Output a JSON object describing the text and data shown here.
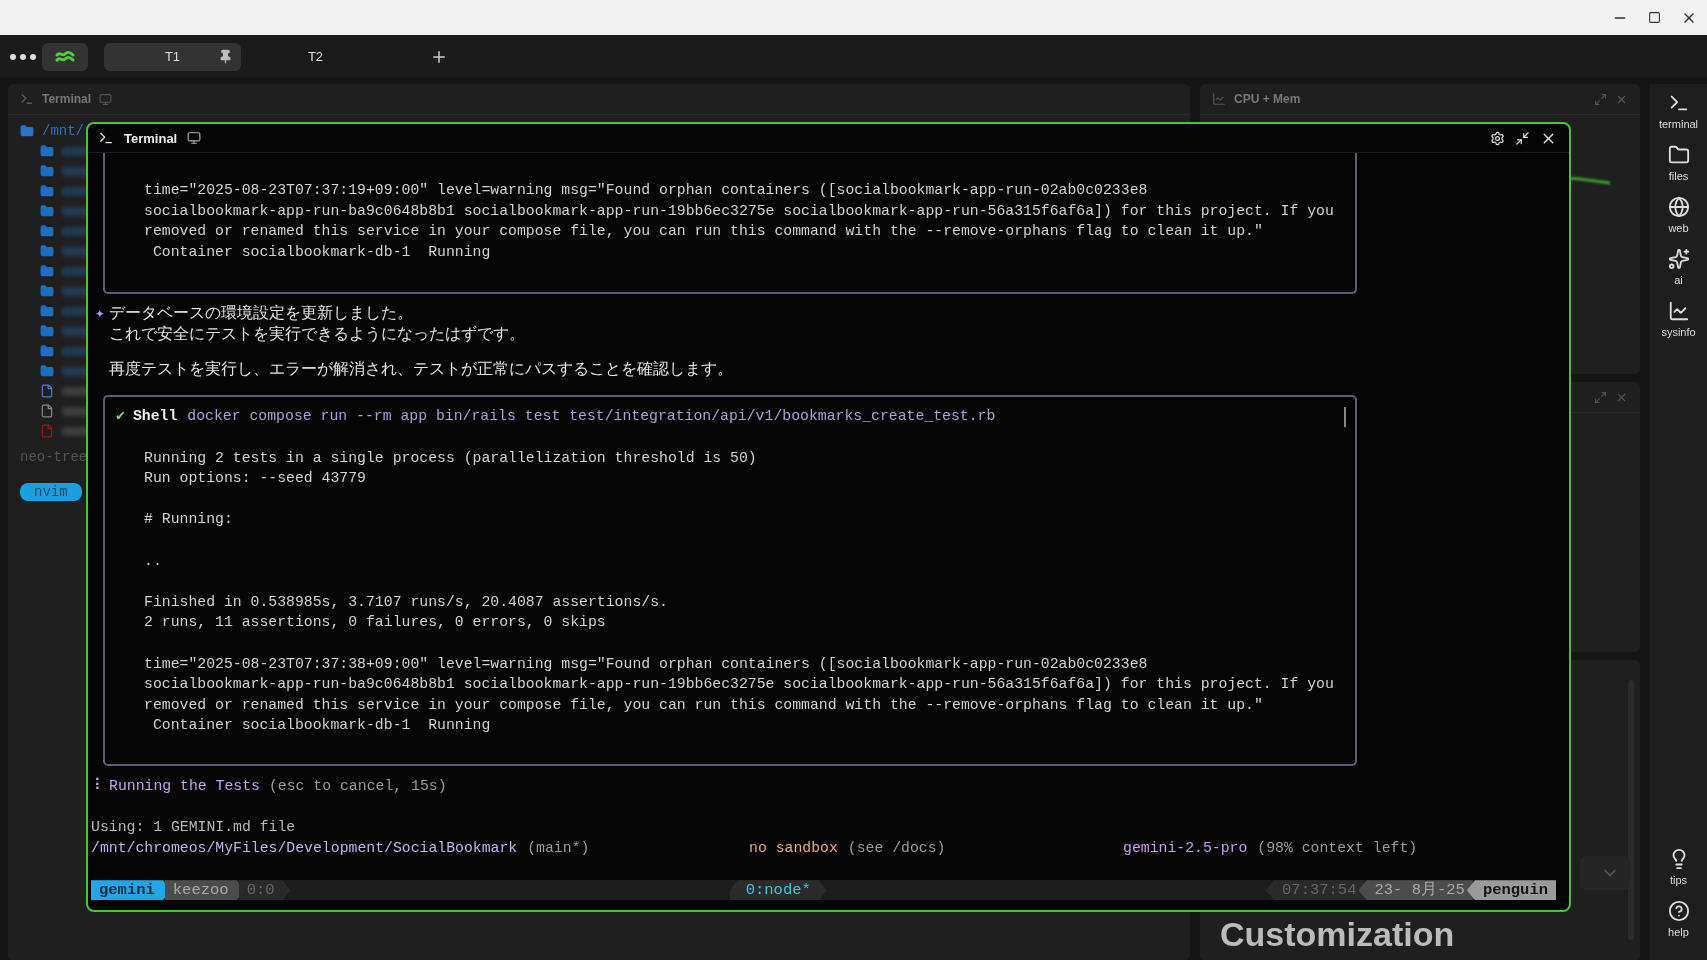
{
  "tabs": [
    {
      "label": "T1",
      "selected": true,
      "pinned": true
    },
    {
      "label": "T2",
      "selected": false,
      "pinned": false
    }
  ],
  "background": {
    "left_panel": {
      "title": "Terminal",
      "tree_root": "/mnt/",
      "tree_label": "neo-tree",
      "mode": "nvim"
    },
    "top_right_panel": {
      "title": "CPU + Mem"
    },
    "bottom_right_panel": {
      "heading": "Customization"
    }
  },
  "sidebar": {
    "top": [
      "terminal",
      "files",
      "web",
      "ai",
      "sysinfo"
    ],
    "bottom": [
      "tips",
      "help"
    ]
  },
  "terminal": {
    "title": "Terminal",
    "blocks": [
      {
        "kind": "output",
        "paragraphs": [
          [
            "time=\"2025-08-23T07:37:19+09:00\" level=warning msg=\"Found orphan containers ([socialbookmark-app-run-02ab0c0233e8",
            "socialbookmark-app-run-ba9c0648b8b1 socialbookmark-app-run-19bb6ec3275e socialbookmark-app-run-56a315f6af6a]) for this project. If you",
            "removed or renamed this service in your compose file, you can run this command with the --remove-orphans flag to clean it up.\"",
            " Container socialbookmark-db-1  Running"
          ]
        ]
      },
      {
        "kind": "message",
        "marker": "✦",
        "lines": [
          "データベースの環境設定を更新しました。",
          "これで安全にテストを実行できるようになったはずです。"
        ]
      },
      {
        "kind": "message",
        "lines": [
          "再度テストを実行し、エラーが解消され、テストが正常にパスすることを確認します。"
        ]
      },
      {
        "kind": "shell",
        "check": "✔",
        "tool": "Shell",
        "command": "docker compose run --rm app bin/rails test test/integration/api/v1/bookmarks_create_test.rb",
        "paragraphs": [
          [
            "Running 2 tests in a single process (parallelization threshold is 50)",
            "Run options: --seed 43779"
          ],
          [
            "# Running:"
          ],
          [
            ".."
          ],
          [
            "Finished in 0.538985s, 3.7107 runs/s, 20.4087 assertions/s.",
            "2 runs, 11 assertions, 0 failures, 0 errors, 0 skips"
          ],
          [
            "time=\"2025-08-23T07:37:38+09:00\" level=warning msg=\"Found orphan containers ([socialbookmark-app-run-02ab0c0233e8",
            "socialbookmark-app-run-ba9c0648b8b1 socialbookmark-app-run-19bb6ec3275e socialbookmark-app-run-56a315f6af6a]) for this project. If you",
            "removed or renamed this service in your compose file, you can run this command with the --remove-orphans flag to clean it up.\"",
            " Container socialbookmark-db-1  Running"
          ]
        ]
      }
    ],
    "spinner": {
      "glyph": "⠇",
      "label": "Running the Tests",
      "hint": "(esc to cancel, 15s)"
    },
    "context_line": "Using: 1 GEMINI.md file",
    "footer": {
      "path": "/mnt/chromeos/MyFiles/Development/SocialBookmark",
      "branch": "(main*)",
      "sandbox": "no sandbox",
      "sandbox_hint": "(see /docs)",
      "model": "gemini-2.5-pro",
      "context": "(98% context left)"
    },
    "tmux": {
      "left": [
        {
          "label": "gemini",
          "kind": "session"
        },
        {
          "label": "keezoo",
          "kind": "host"
        },
        {
          "label": "0:0",
          "kind": "pane"
        }
      ],
      "center": [
        {
          "label": "0:node*",
          "selected": true
        }
      ],
      "right": [
        {
          "label": "07:37:54",
          "kind": "time"
        },
        {
          "label": "23- 8月-25",
          "kind": "date"
        },
        {
          "label": "penguin",
          "kind": "host"
        }
      ]
    }
  }
}
